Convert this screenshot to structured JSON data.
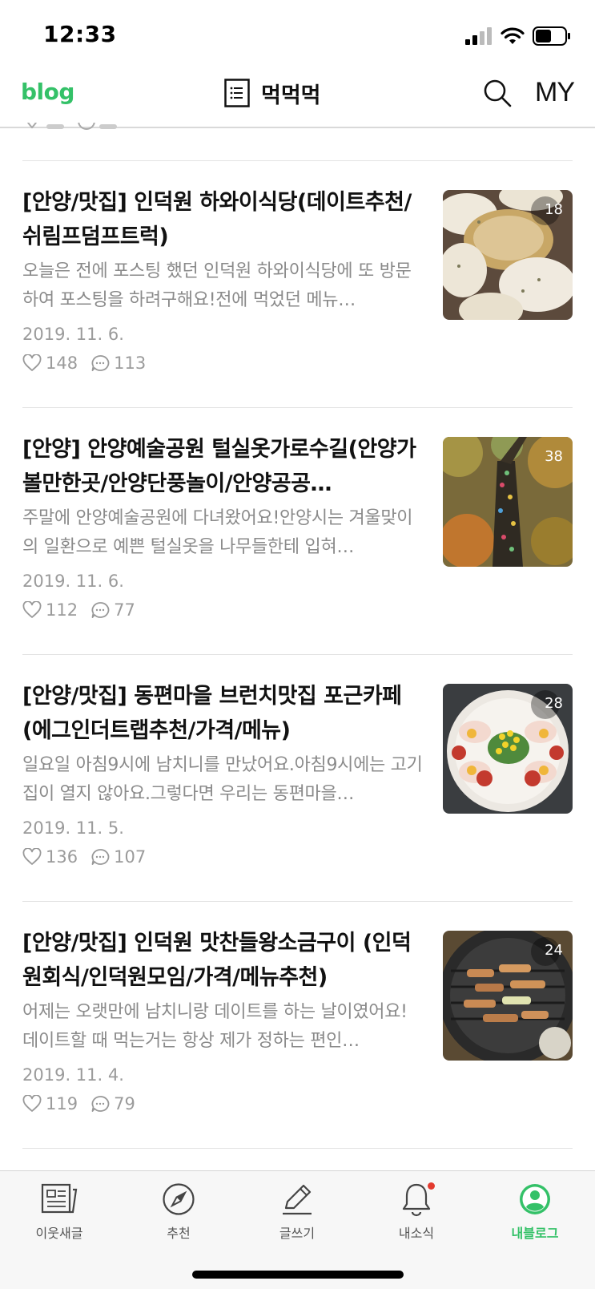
{
  "status": {
    "time": "12:33"
  },
  "header": {
    "logo": "blog",
    "title": "먹먹먹",
    "my": "MY"
  },
  "posts": [
    {
      "title": "[안양/맛집] 인덕원 하와이식당(데이트추천/쉬림프덤프트럭)",
      "summary": "오늘은 전에 포스팅 했던 인덕원 하와이식당에 또 방문하여 포스팅을 하려구해요!전에 먹었던 메뉴…",
      "date": "2019. 11. 6.",
      "likes": "148",
      "comments": "113",
      "photo_count": "18"
    },
    {
      "title": "[안양] 안양예술공원 털실옷가로수길(안양가볼만한곳/안양단풍놀이/안양공공…",
      "summary": "주말에 안양예술공원에 다녀왔어요!안양시는 겨울맞이의 일환으로 예쁜 털실옷을 나무들한테 입혀…",
      "date": "2019. 11. 6.",
      "likes": "112",
      "comments": "77",
      "photo_count": "38"
    },
    {
      "title": "[안양/맛집] 동편마을 브런치맛집 포근카페(에그인더트랩추천/가격/메뉴)",
      "summary": "일요일 아침9시에 남치니를 만났어요.아침9시에는 고기집이 열지 않아요.그렇다면 우리는 동편마을…",
      "date": "2019. 11. 5.",
      "likes": "136",
      "comments": "107",
      "photo_count": "28"
    },
    {
      "title": "[안양/맛집] 인덕원 맛찬들왕소금구이 (인덕원회식/인덕원모임/가격/메뉴추천)",
      "summary": "어제는 오랫만에 남치니랑 데이트를 하는 날이였어요!데이트할 때 먹는거는 항상 제가 정하는 편인…",
      "date": "2019. 11. 4.",
      "likes": "119",
      "comments": "79",
      "photo_count": "24"
    }
  ],
  "tabs": [
    {
      "label": "이웃새글",
      "icon": "news-icon"
    },
    {
      "label": "추천",
      "icon": "compass-icon"
    },
    {
      "label": "글쓰기",
      "icon": "pencil-icon"
    },
    {
      "label": "내소식",
      "icon": "bell-icon"
    },
    {
      "label": "내블로그",
      "icon": "profile-icon",
      "active": true
    }
  ],
  "colors": {
    "accent": "#34c168",
    "notification": "#e33b2f"
  }
}
